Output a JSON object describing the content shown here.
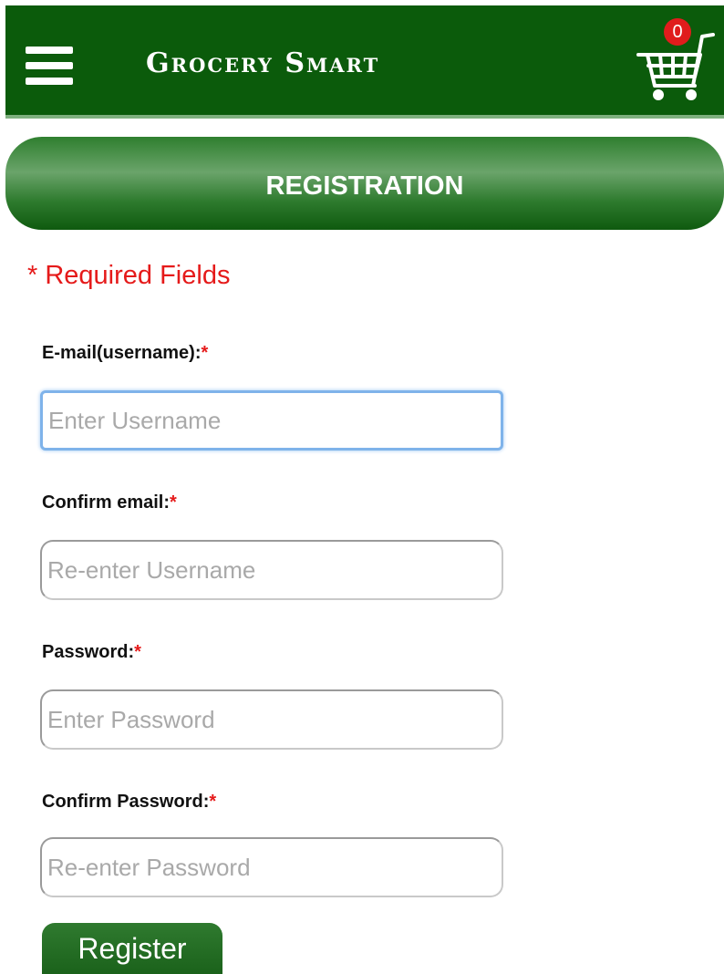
{
  "header": {
    "brand": "Grocery Smart",
    "cart_count": "0"
  },
  "page_title": "REGISTRATION",
  "required_note": "* Required Fields",
  "form": {
    "required_marker": "*",
    "email": {
      "label": "E-mail(username):",
      "placeholder": "Enter Username",
      "value": ""
    },
    "confirm_email": {
      "label": "Confirm email:",
      "placeholder": "Re-enter Username",
      "value": ""
    },
    "password": {
      "label": "Password:",
      "placeholder": "Enter Password",
      "value": ""
    },
    "confirm_password": {
      "label": "Confirm Password:",
      "placeholder": "Re-enter Password",
      "value": ""
    },
    "submit_label": "Register"
  },
  "icons": [
    "hamburger-menu-icon",
    "shopping-cart-icon"
  ],
  "colors": {
    "header_bg": "#0b5b0b",
    "required_red": "#e51a1a",
    "badge_red": "#e01c1c",
    "focus_blue": "#7fb3ea"
  }
}
